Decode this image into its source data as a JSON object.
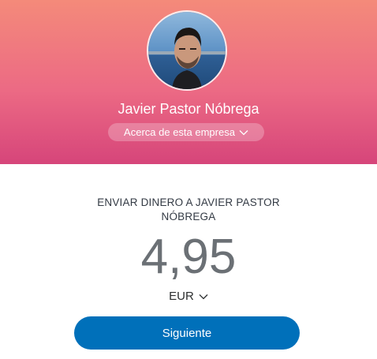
{
  "profile": {
    "name": "Javier Pastor Nóbrega",
    "about_label": "Acerca de esta empresa",
    "header_gradient": [
      "#f48a7a",
      "#ec6a84",
      "#d6457a"
    ]
  },
  "payment": {
    "send_to_label": "ENVIAR DINERO A JAVIER PASTOR NÓBREGA",
    "amount": "4,95",
    "currency": "EUR"
  },
  "actions": {
    "next_label": "Siguiente",
    "next_color": "#0070ba"
  },
  "icons": {
    "about_chevron": "chevron-down-icon",
    "currency_chevron": "chevron-down-icon"
  }
}
